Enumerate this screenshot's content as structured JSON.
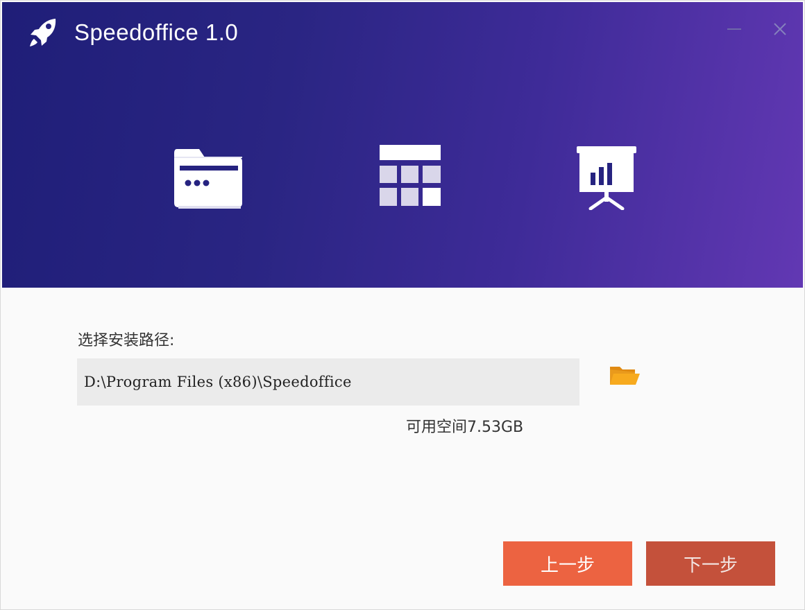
{
  "window": {
    "title": "Speedoffice 1.0"
  },
  "icons": {
    "logo": "rocket-icon",
    "minimize": "minimize-icon",
    "close": "close-icon",
    "features": [
      "document-folder-icon",
      "spreadsheet-icon",
      "presentation-icon"
    ],
    "browse": "folder-icon"
  },
  "colors": {
    "header_gradient_start": "#1f1e78",
    "header_gradient_end": "#6238b3",
    "prev_button": "#ec6341",
    "next_button": "#c4513b",
    "folder_icon": "#f5a623"
  },
  "install": {
    "label": "选择安装路径:",
    "path_value": "D:\\Program Files (x86)\\Speedoffice",
    "available_space": "可用空间7.53GB"
  },
  "buttons": {
    "prev_label": "上一步",
    "next_label": "下一步"
  }
}
